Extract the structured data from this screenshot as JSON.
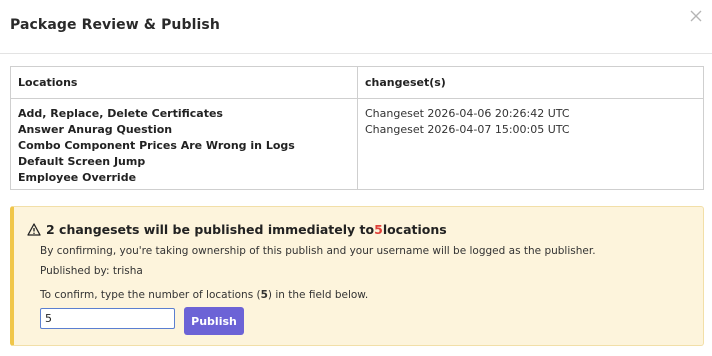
{
  "header": {
    "title": "Package Review & Publish",
    "close_label": "×"
  },
  "table": {
    "columns": [
      "Locations",
      "changeset(s)"
    ],
    "locations": [
      "Add, Replace, Delete Certificates",
      "Answer Anurag Question",
      "Combo Component Prices Are Wrong in Logs",
      "Default Screen Jump",
      "Employee Override"
    ],
    "changesets": [
      "Changeset 2026-04-06 20:26:42 UTC",
      "Changeset 2026-04-07 15:00:05 UTC"
    ]
  },
  "warning": {
    "icon": "warning-triangle-icon",
    "headline_prefix": "2 changesets will be published immediately to ",
    "headline_count": "5",
    "headline_suffix": " locations",
    "ownership_text": "By confirming, you're taking ownership of this publish and your username will be logged as the publisher.",
    "published_by": "Published by: trisha",
    "confirm_prefix": "To confirm, type the number of locations (",
    "confirm_count": "5",
    "confirm_suffix": ") in the field below.",
    "input_value": "5",
    "publish_label": "Publish",
    "count_color": "#e0413a",
    "accent_color": "#6c63d6"
  }
}
